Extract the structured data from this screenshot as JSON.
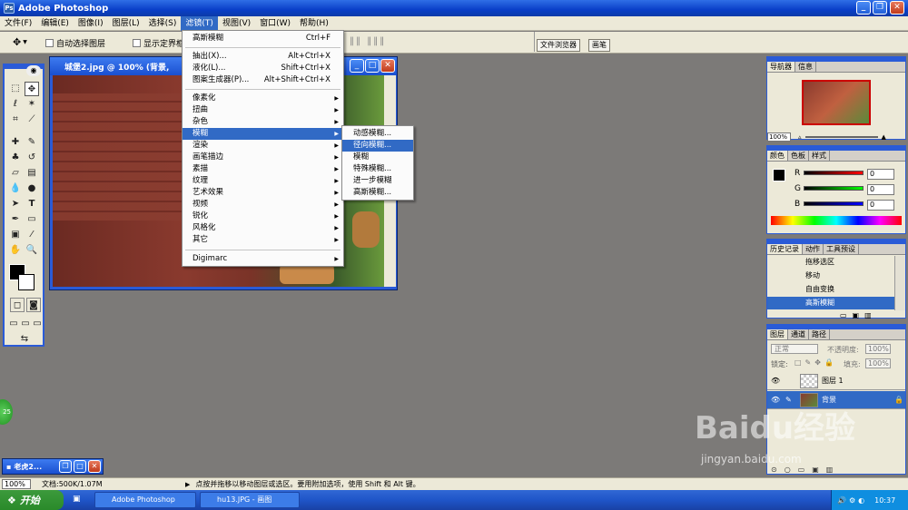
{
  "window": {
    "title": "Adobe Photoshop"
  },
  "menubar": [
    "文件(F)",
    "编辑(E)",
    "图像(I)",
    "图层(L)",
    "选择(S)",
    "滤镜(T)",
    "视图(V)",
    "窗口(W)",
    "帮助(H)"
  ],
  "options": {
    "auto_select": "自动选择图层",
    "show_bounds": "显示定界框",
    "file_browser": "文件浏览器",
    "brushes": "画笔"
  },
  "document": {
    "title": "城堡2.jpg @ 100% (背景,"
  },
  "filter_menu": {
    "last_filter": "高斯模糊",
    "last_filter_shortcut": "Ctrl+F",
    "extract": "抽出(X)...",
    "extract_shortcut": "Alt+Ctrl+X",
    "liquify": "液化(L)...",
    "liquify_shortcut": "Shift+Ctrl+X",
    "pattern": "图案生成器(P)...",
    "pattern_shortcut": "Alt+Shift+Ctrl+X",
    "groups": [
      "像素化",
      "扭曲",
      "杂色",
      "模糊",
      "渲染",
      "画笔描边",
      "素描",
      "纹理",
      "艺术效果",
      "视频",
      "锐化",
      "风格化",
      "其它"
    ],
    "digimarc": "Digimarc"
  },
  "blur_submenu": [
    "动感模糊...",
    "径向模糊...",
    "模糊",
    "特殊模糊...",
    "进一步模糊",
    "高斯模糊..."
  ],
  "navigator": {
    "tabs": [
      "导航器",
      "信息"
    ],
    "zoom": "100%"
  },
  "color": {
    "tabs": [
      "颜色",
      "色板",
      "样式"
    ],
    "channels": [
      {
        "label": "R",
        "value": "0"
      },
      {
        "label": "G",
        "value": "0"
      },
      {
        "label": "B",
        "value": "0"
      }
    ]
  },
  "history": {
    "tabs": [
      "历史记录",
      "动作",
      "工具预设"
    ],
    "items": [
      "拖移选区",
      "移动",
      "自由变换",
      "高斯模糊"
    ]
  },
  "layers": {
    "tabs": [
      "图层",
      "通道",
      "路径"
    ],
    "blend_mode": "正常",
    "opacity_label": "不透明度:",
    "opacity_value": "100%",
    "lock_label": "锁定:",
    "fill_label": "填充:",
    "fill_value": "100%",
    "rows": [
      "图层 1",
      "背景"
    ]
  },
  "minimized_doc": {
    "title": "老虎2..."
  },
  "status": {
    "zoom": "100%",
    "doc_size": "文档:500K/1.07M",
    "hint": "点按并拖移以移动图层或选区。要用附加选项，使用 Shift 和 Alt 键。"
  },
  "taskbar": {
    "start": "开始",
    "tasks": [
      "Adobe Photoshop",
      "hu13.JPG - 画图"
    ],
    "clock": "10:37"
  },
  "watermark": {
    "text": "Baidu经验",
    "url": "jingyan.baidu.com"
  }
}
